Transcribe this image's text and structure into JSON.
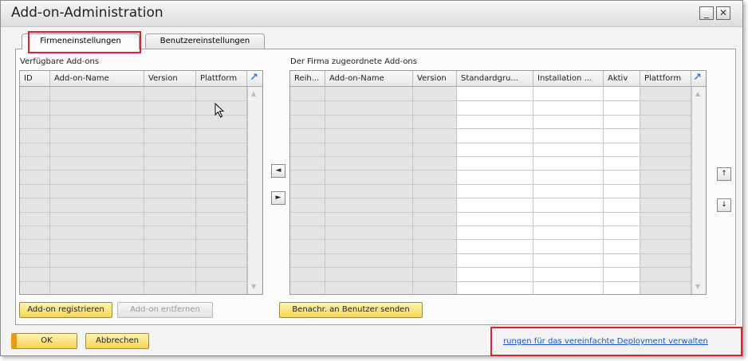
{
  "window": {
    "title": "Add-on-Administration",
    "minimize_label": "_",
    "close_label": "✕"
  },
  "tabs": [
    {
      "label": "Firmeneinstellungen",
      "active": true
    },
    {
      "label": "Benutzereinstellungen",
      "active": false
    }
  ],
  "available": {
    "label": "Verfügbare Add-ons",
    "columns": [
      "ID",
      "Add-on-Name",
      "Version",
      "Plattform"
    ],
    "rows": []
  },
  "assigned": {
    "label": "Der Firma zugeordnete Add-ons",
    "columns": [
      "Reih...",
      "Add-on-Name",
      "Version",
      "Standardgru...",
      "Installation ...",
      "Aktiv",
      "Plattform"
    ],
    "rows": []
  },
  "buttons": {
    "register": "Add-on registrieren",
    "remove": "Add-on entfernen",
    "notify": "Benachr. an Benutzer senden",
    "ok": "OK",
    "cancel": "Abbrechen"
  },
  "movers": {
    "move_left": "◄",
    "move_right": "►",
    "up": "↑",
    "down": "↓"
  },
  "footer_link": "rungen für das vereinfachte Deployment verwalten",
  "icons": {
    "expand": "expand-arrow-icon",
    "cursor": "mouse-pointer-icon"
  },
  "colors": {
    "highlight_box": "#d9242d",
    "button_yellow": "#f6d54e",
    "link_blue": "#1d4fd6",
    "expand_blue": "#3a7bd5"
  }
}
